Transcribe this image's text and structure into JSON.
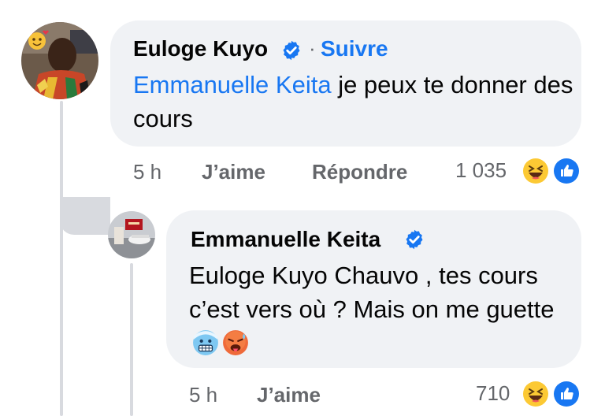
{
  "comment": {
    "author": "Euloge Kuyo",
    "separator": "·",
    "follow_label": "Suivre",
    "mention": "Emmanuelle Keita",
    "text": " je peux te donner des cours",
    "time": "5 h",
    "like_label": "J’aime",
    "reply_label": "Répondre",
    "reaction_count": "1 035",
    "reactions": [
      "haha-icon",
      "like-icon"
    ]
  },
  "reply": {
    "author": "Emmanuelle Keita",
    "text": "Euloge Kuyo Chauvo , tes cours c’est vers où ? Mais on me guette",
    "emojis": [
      "cold-face-icon",
      "hot-face-icon"
    ],
    "time": "5 h",
    "like_label": "J’aime",
    "reaction_count": "710",
    "reactions": [
      "haha-icon",
      "like-icon"
    ]
  },
  "colors": {
    "link": "#1877f2",
    "bubble": "#f0f2f5",
    "secondary_text": "#65676b",
    "thread_line": "#d8dadf"
  }
}
